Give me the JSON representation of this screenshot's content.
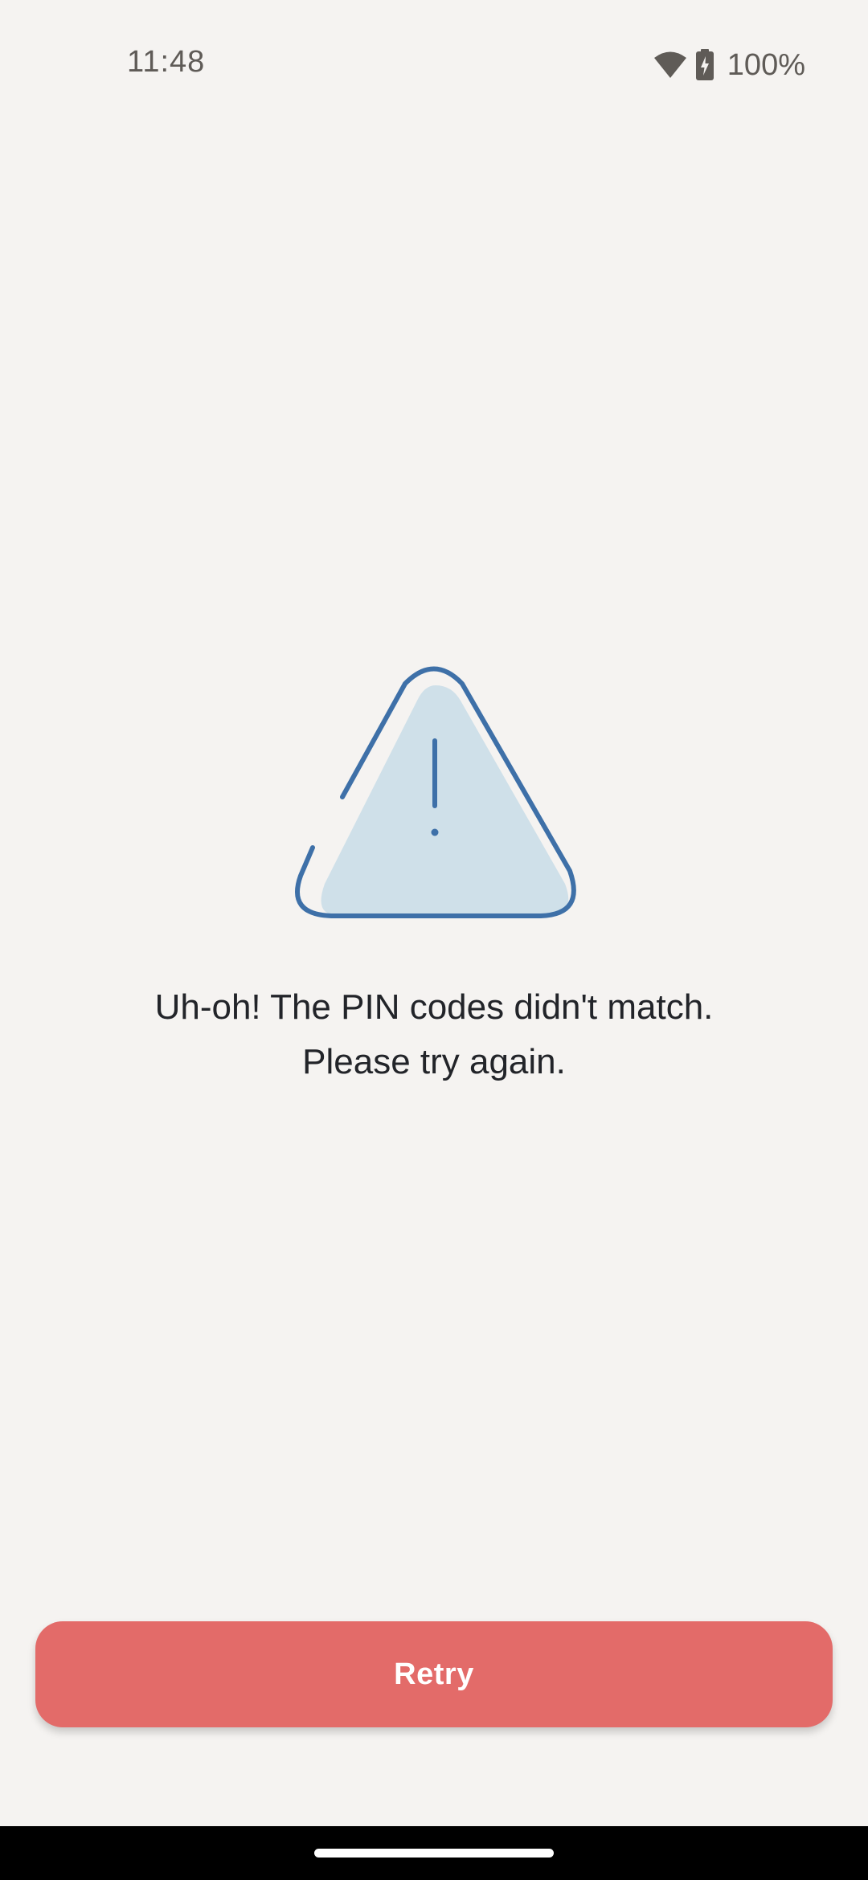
{
  "status_bar": {
    "time": "11:48",
    "battery_percent": "100%",
    "icons": [
      "wifi-icon",
      "battery-charging-icon"
    ]
  },
  "illustration": {
    "icon": "warning-triangle-icon",
    "stroke_color": "#3e70a8",
    "fill_color": "#cfe0e9"
  },
  "message": {
    "line1": "Uh-oh! The PIN codes didn't match.",
    "line2": "Please try again."
  },
  "actions": {
    "retry_label": "Retry",
    "retry_color": "#e36b69"
  }
}
